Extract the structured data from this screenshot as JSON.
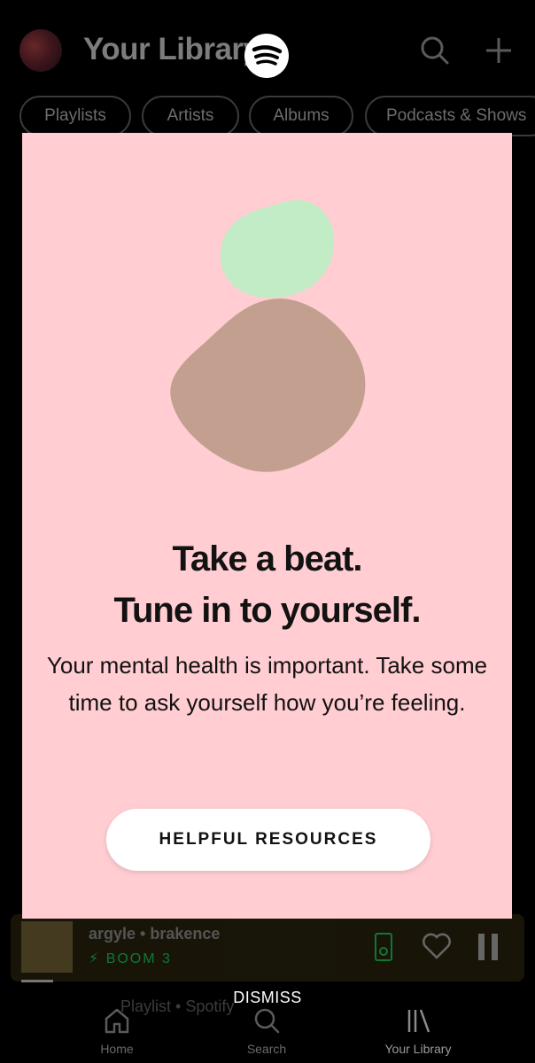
{
  "header": {
    "title": "Your Library",
    "avatar_icon": "avatar-photo",
    "logo_icon": "spotify-logo-icon",
    "search_icon": "search-icon",
    "add_icon": "plus-icon"
  },
  "filters": [
    "Playlists",
    "Artists",
    "Albums",
    "Podcasts & Shows"
  ],
  "modal": {
    "headline_1": "Take a beat.",
    "headline_2": "Tune in to yourself.",
    "body": "Your mental health is important. Take some time to ask yourself how you’re feeling.",
    "button_label": "HELPFUL RESOURCES",
    "background_color": "#ffcdd2",
    "shape_colors": [
      "#c1ecc6",
      "#c29f8e"
    ]
  },
  "dismiss_label": "DISMISS",
  "mini_player": {
    "title": "argyle • brakence",
    "subtitle": "BOOM 3"
  },
  "background_text": "Playlist • Spotify",
  "bottom_nav": [
    {
      "label": "Home",
      "icon": "home-icon"
    },
    {
      "label": "Search",
      "icon": "search-icon"
    },
    {
      "label": "Your Library",
      "icon": "library-icon"
    }
  ],
  "colors": {
    "accent": "#1ed760",
    "background": "#000000"
  }
}
